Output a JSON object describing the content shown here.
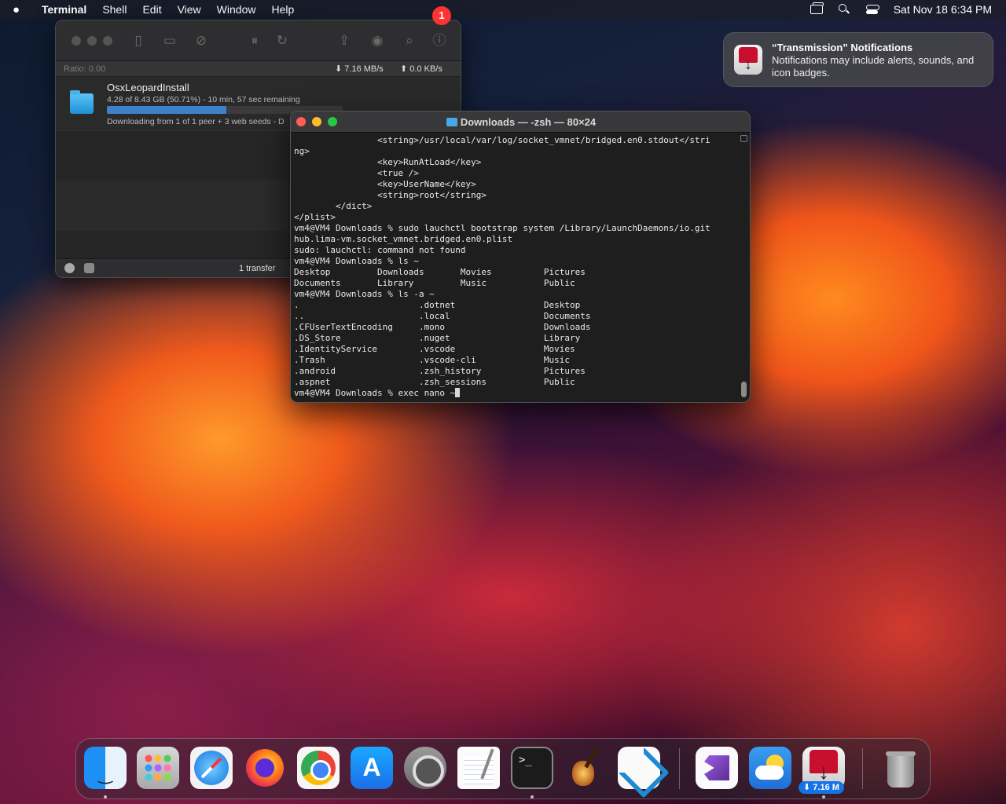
{
  "menubar": {
    "app_name": "Terminal",
    "menus": [
      "Shell",
      "Edit",
      "View",
      "Window",
      "Help"
    ],
    "datetime": "Sat Nov 18  6:34 PM"
  },
  "transmission": {
    "ratio": "Ratio: 0.00",
    "download_speed": "7.16 MB/s",
    "upload_speed": "0.0 KB/s",
    "torrent": {
      "name": "OsxLeopardInstall",
      "progress_text": "4.28 of 8.43 GB (50.71%) - 10 min, 57 sec remaining",
      "progress_percent": 50.71,
      "status_text": "Downloading from 1 of 1 peer + 3 web seeds - D"
    },
    "footer_count": "1 transfer"
  },
  "terminal": {
    "title": "Downloads — -zsh — 80×24",
    "lines": [
      "                <string>/usr/local/var/log/socket_vmnet/bridged.en0.stdout</stri",
      "ng>",
      "                <key>RunAtLoad</key>",
      "                <true />",
      "                <key>UserName</key>",
      "                <string>root</string>",
      "        </dict>",
      "</plist>",
      "vm4@VM4 Downloads % sudo lauchctl bootstrap system /Library/LaunchDaemons/io.git",
      "hub.lima-vm.socket_vmnet.bridged.en0.plist",
      "sudo: lauchctl: command not found",
      "vm4@VM4 Downloads % ls ~",
      "Desktop         Downloads       Movies          Pictures",
      "Documents       Library         Music           Public",
      "vm4@VM4 Downloads % ls -a ~",
      ".                       .dotnet                 Desktop",
      "..                      .local                  Documents",
      ".CFUserTextEncoding     .mono                   Downloads",
      ".DS_Store               .nuget                  Library",
      ".IdentityService        .vscode                 Movies",
      ".Trash                  .vscode-cli             Music",
      ".android                .zsh_history            Pictures",
      ".aspnet                 .zsh_sessions           Public"
    ],
    "prompt_line": "vm4@VM4 Downloads % exec nano ~"
  },
  "notification": {
    "title": "“Transmission” Notifications",
    "body": "Notifications may include alerts, sounds, and icon badges."
  },
  "dock": {
    "settings_badge": "1",
    "transmission_badge": "⬇ 7.16 M"
  }
}
